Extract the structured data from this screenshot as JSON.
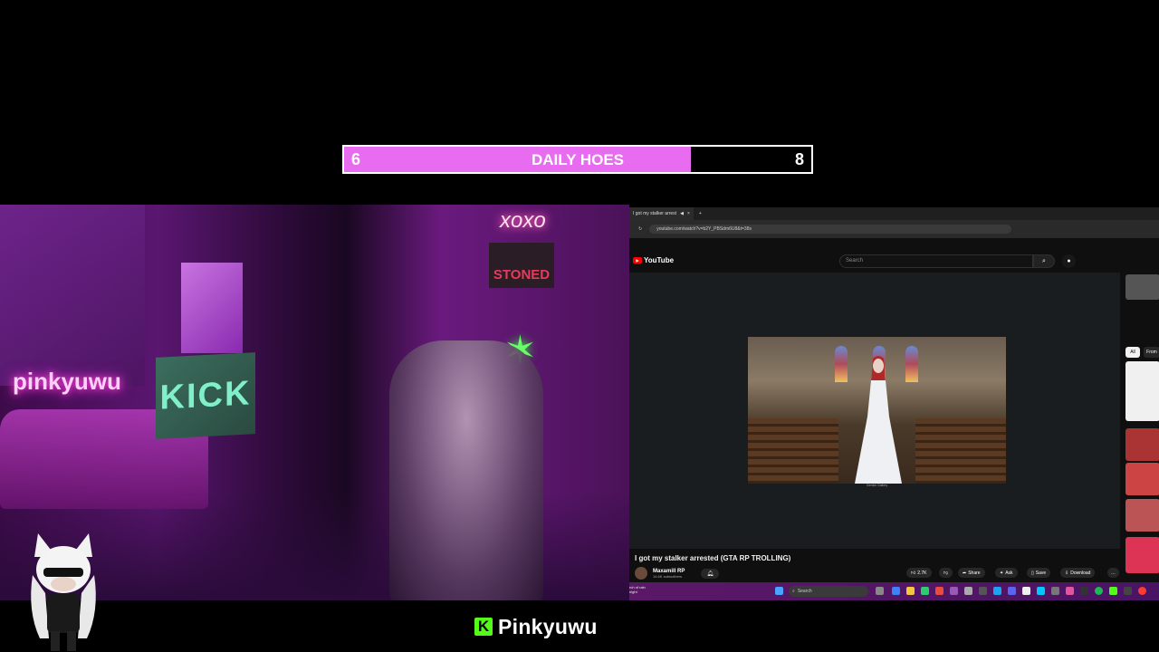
{
  "goal": {
    "current": "6",
    "title": "DAILY HOES",
    "target": "8",
    "progress_fraction": 0.742,
    "fill_color": "#e86cf0"
  },
  "webcam": {
    "neon_left": "pinkyuwu",
    "neon_top": "xoxo",
    "sign_stoned": "STONED",
    "sign_kick": "KICK"
  },
  "browser": {
    "tab_title": "I got my stalker arrest",
    "url": "youtube.com/watch?v=b2Y_PBSdm6U8&t=38s"
  },
  "youtube": {
    "logo": "YouTube",
    "search_placeholder": "Search",
    "video_caption": "Gemini Gallery",
    "video_title": "I got my stalker arrested (GTA RP TROLLING)",
    "channel_name": "Maxamill RP",
    "channel_subs": "14.6K subscribers",
    "likes": "2.7K",
    "share": "Share",
    "ask": "Ask",
    "save": "Save",
    "download": "Download",
    "chip_all": "All",
    "chip_from": "From"
  },
  "taskbar": {
    "weather_line1": "rch of rain",
    "weather_line2": "night",
    "search_label": "Search"
  },
  "brand": {
    "name": "Pinkyuwu",
    "icon": "kick-logo-icon",
    "color": "#53fc18"
  }
}
